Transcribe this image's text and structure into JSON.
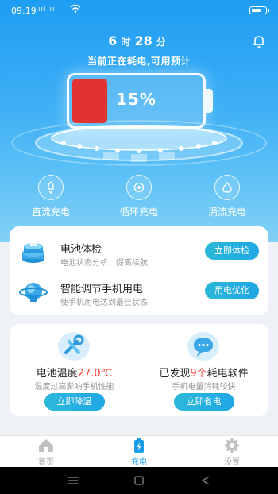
{
  "status_bar": {
    "time": "09:19",
    "signal": "ııl ııl"
  },
  "header": {
    "hours": "6",
    "hours_unit": "时",
    "minutes": "28",
    "minutes_unit": "分",
    "subtitle": "当前正在耗电,可用预计"
  },
  "battery": {
    "percent_text": "15%",
    "level": 15,
    "fill_color": "#e23333"
  },
  "charge_modes": [
    {
      "label": "直流充电",
      "icon": "rocket-icon"
    },
    {
      "label": "循环充电",
      "icon": "cycle-icon"
    },
    {
      "label": "涓流充电",
      "icon": "drop-icon"
    }
  ],
  "features": [
    {
      "title": "电池体检",
      "desc": "电池状态分析，提高续航",
      "button": "立即体检",
      "icon": "battery-stack-icon"
    },
    {
      "title": "智能调节手机用电",
      "desc": "使手机用电达到最佳状态",
      "button": "用电优化",
      "icon": "planet-icon"
    }
  ],
  "temperature": {
    "title_prefix": "电池温度",
    "value": "27.0℃",
    "desc": "温度过高影响手机性能",
    "button": "立即降温"
  },
  "power_apps": {
    "title_prefix": "已发现",
    "count": "9个",
    "title_suffix": "耗电软件",
    "desc": "手机电量消耗较快",
    "button": "立即省电"
  },
  "tabs": [
    {
      "label": "首页",
      "active": false
    },
    {
      "label": "充电",
      "active": true
    },
    {
      "label": "设置",
      "active": false
    }
  ],
  "colors": {
    "accent": "#1a9ce8",
    "hero_top": "#1e9df2",
    "highlight": "#ff3b30"
  }
}
